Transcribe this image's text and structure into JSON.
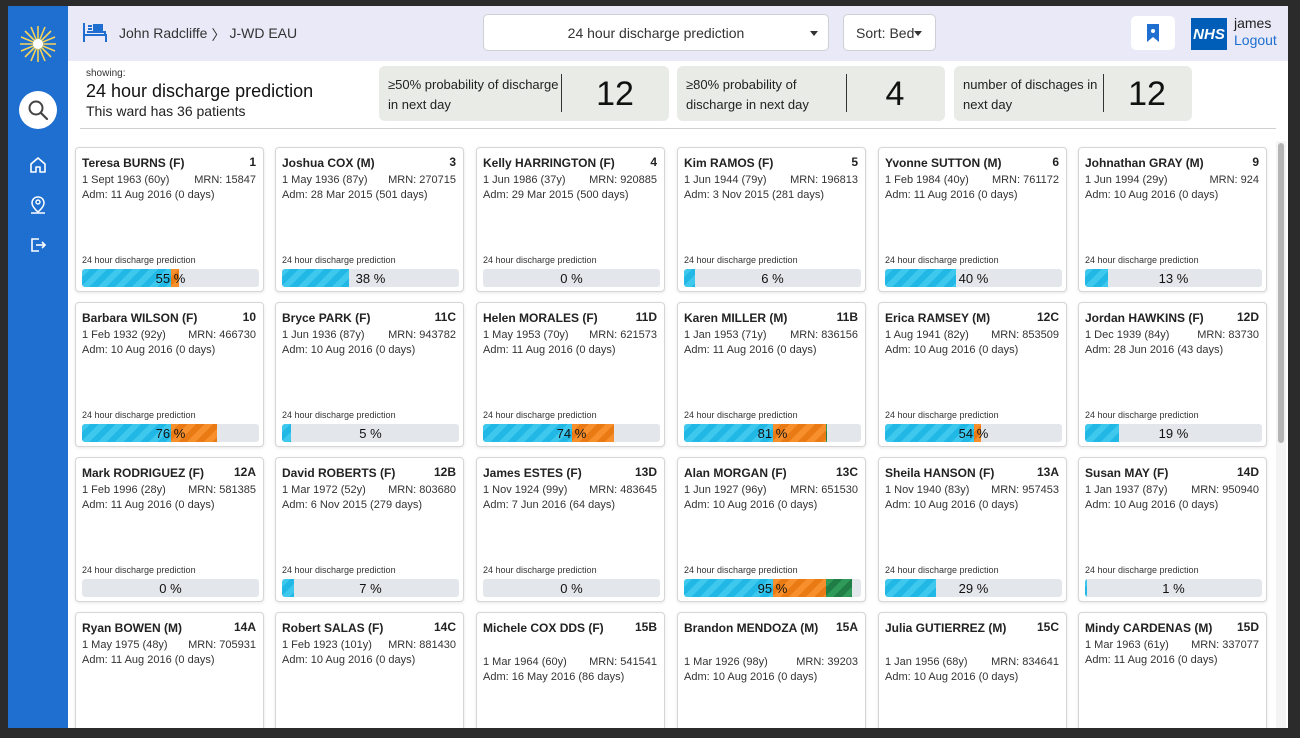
{
  "header": {
    "hospital": "John Radcliffe",
    "separator": "〉",
    "ward": "J-WD EAU",
    "view_selected": "24 hour discharge prediction",
    "sort_selected": "Sort: Bed",
    "user": "james",
    "logout": "Logout",
    "nhs_logo": "NHS"
  },
  "sidebar": {
    "icons": [
      "logo-icon",
      "search-icon",
      "home-icon",
      "person-pin-icon",
      "logout-icon"
    ],
    "color": "#1e6fd0"
  },
  "summary": {
    "showing_label": "showing:",
    "title": "24 hour discharge prediction",
    "ward_count": "This ward has 36 patients",
    "stats": [
      {
        "label": "≥50% probability of discharge in next day",
        "value": "12"
      },
      {
        "label": "≥80% probability of discharge in next day",
        "value": "4"
      },
      {
        "label": "number of dischages in next day",
        "value": "12"
      }
    ]
  },
  "prediction_label": "24 hour discharge prediction",
  "colors": {
    "band_low": "#22b8e6",
    "band_mid": "#f7902c",
    "band_high": "#2f9a5a",
    "accent": "#1e6fd0"
  },
  "patients": [
    {
      "name": "Teresa BURNS (F)",
      "bed": "1",
      "dob": "1 Sept 1963 (60y)",
      "mrn": "MRN: 15847",
      "adm": "Adm: 11 Aug 2016 (0 days)",
      "pct": 55,
      "label": "55 %"
    },
    {
      "name": "Joshua COX (M)",
      "bed": "3",
      "dob": "1 May 1936 (87y)",
      "mrn": "MRN: 270715",
      "adm": "Adm: 28 Mar 2015 (501 days)",
      "pct": 38,
      "label": "38 %"
    },
    {
      "name": "Kelly HARRINGTON (F)",
      "bed": "4",
      "dob": "1 Jun 1986 (37y)",
      "mrn": "MRN: 920885",
      "adm": "Adm: 29 Mar 2015 (500 days)",
      "pct": 0,
      "label": "0 %"
    },
    {
      "name": "Kim RAMOS (F)",
      "bed": "5",
      "dob": "1 Jun 1944 (79y)",
      "mrn": "MRN: 196813",
      "adm": "Adm: 3 Nov 2015 (281 days)",
      "pct": 6,
      "label": "6 %"
    },
    {
      "name": "Yvonne SUTTON (M)",
      "bed": "6",
      "dob": "1 Feb 1984 (40y)",
      "mrn": "MRN: 761172",
      "adm": "Adm: 11 Aug 2016 (0 days)",
      "pct": 40,
      "label": "40 %"
    },
    {
      "name": "Johnathan GRAY (M)",
      "bed": "9",
      "dob": "1 Jun 1994 (29y)",
      "mrn": "MRN: 924",
      "adm": "Adm: 10 Aug 2016 (0 days)",
      "pct": 13,
      "label": "13 %"
    },
    {
      "name": "Barbara WILSON (F)",
      "bed": "10",
      "dob": "1 Feb 1932 (92y)",
      "mrn": "MRN: 466730",
      "adm": "Adm: 10 Aug 2016 (0 days)",
      "pct": 76,
      "label": "76 %"
    },
    {
      "name": "Bryce PARK (F)",
      "bed": "11C",
      "dob": "1 Jun 1936 (87y)",
      "mrn": "MRN: 943782",
      "adm": "Adm: 10 Aug 2016 (0 days)",
      "pct": 5,
      "label": "5 %"
    },
    {
      "name": "Helen MORALES (F)",
      "bed": "11D",
      "dob": "1 May 1953 (70y)",
      "mrn": "MRN: 621573",
      "adm": "Adm: 11 Aug 2016 (0 days)",
      "pct": 74,
      "label": "74 %"
    },
    {
      "name": "Karen MILLER (M)",
      "bed": "11B",
      "dob": "1 Jan 1953 (71y)",
      "mrn": "MRN: 836156",
      "adm": "Adm: 11 Aug 2016 (0 days)",
      "pct": 81,
      "label": "81 %"
    },
    {
      "name": "Erica RAMSEY (M)",
      "bed": "12C",
      "dob": "1 Aug 1941 (82y)",
      "mrn": "MRN: 853509",
      "adm": "Adm: 10 Aug 2016 (0 days)",
      "pct": 54,
      "label": "54 %"
    },
    {
      "name": "Jordan HAWKINS (F)",
      "bed": "12D",
      "dob": "1 Dec 1939 (84y)",
      "mrn": "MRN: 83730",
      "adm": "Adm: 28 Jun 2016 (43 days)",
      "pct": 19,
      "label": "19 %"
    },
    {
      "name": "Mark RODRIGUEZ (F)",
      "bed": "12A",
      "dob": "1 Feb 1996 (28y)",
      "mrn": "MRN: 581385",
      "adm": "Adm: 11 Aug 2016 (0 days)",
      "pct": 0,
      "label": "0 %"
    },
    {
      "name": "David ROBERTS (F)",
      "bed": "12B",
      "dob": "1 Mar 1972 (52y)",
      "mrn": "MRN: 803680",
      "adm": "Adm: 6 Nov 2015 (279 days)",
      "pct": 7,
      "label": "7 %"
    },
    {
      "name": "James ESTES (F)",
      "bed": "13D",
      "dob": "1 Nov 1924 (99y)",
      "mrn": "MRN: 483645",
      "adm": "Adm: 7 Jun 2016 (64 days)",
      "pct": 0,
      "label": "0 %"
    },
    {
      "name": "Alan MORGAN (F)",
      "bed": "13C",
      "dob": "1 Jun 1927 (96y)",
      "mrn": "MRN: 651530",
      "adm": "Adm: 10 Aug 2016 (0 days)",
      "pct": 95,
      "label": "95 %"
    },
    {
      "name": "Sheila HANSON (F)",
      "bed": "13A",
      "dob": "1 Nov 1940 (83y)",
      "mrn": "MRN: 957453",
      "adm": "Adm: 10 Aug 2016 (0 days)",
      "pct": 29,
      "label": "29 %"
    },
    {
      "name": "Susan MAY (F)",
      "bed": "14D",
      "dob": "1 Jan 1937 (87y)",
      "mrn": "MRN: 950940",
      "adm": "Adm: 10 Aug 2016 (0 days)",
      "pct": 1,
      "label": "1 %"
    },
    {
      "name": "Ryan BOWEN (M)",
      "bed": "14A",
      "dob": "1 May 1975 (48y)",
      "mrn": "MRN: 705931",
      "adm": "Adm: 11 Aug 2016 (0 days)",
      "pct": null,
      "label": ""
    },
    {
      "name": "Robert SALAS (F)",
      "bed": "14C",
      "dob": "1 Feb 1923 (101y)",
      "mrn": "MRN: 881430",
      "adm": "Adm: 10 Aug 2016 (0 days)",
      "pct": null,
      "label": ""
    },
    {
      "name": "Michele COX DDS (F)",
      "bed": "15B",
      "dob": "1 Mar 1964 (60y)",
      "mrn": "MRN: 541541",
      "adm": "Adm: 16 May 2016 (86 days)",
      "pct": null,
      "label": ""
    },
    {
      "name": "Brandon MENDOZA (M)",
      "bed": "15A",
      "dob": "1 Mar 1926 (98y)",
      "mrn": "MRN: 39203",
      "adm": "Adm: 10 Aug 2016 (0 days)",
      "pct": null,
      "label": ""
    },
    {
      "name": "Julia GUTIERREZ (M)",
      "bed": "15C",
      "dob": "1 Jan 1956 (68y)",
      "mrn": "MRN: 834641",
      "adm": "Adm: 10 Aug 2016 (0 days)",
      "pct": null,
      "label": ""
    },
    {
      "name": "Mindy CARDENAS (M)",
      "bed": "15D",
      "dob": "1 Mar 1963 (61y)",
      "mrn": "MRN: 337077",
      "adm": "Adm: 11 Aug 2016 (0 days)",
      "pct": null,
      "label": ""
    }
  ]
}
